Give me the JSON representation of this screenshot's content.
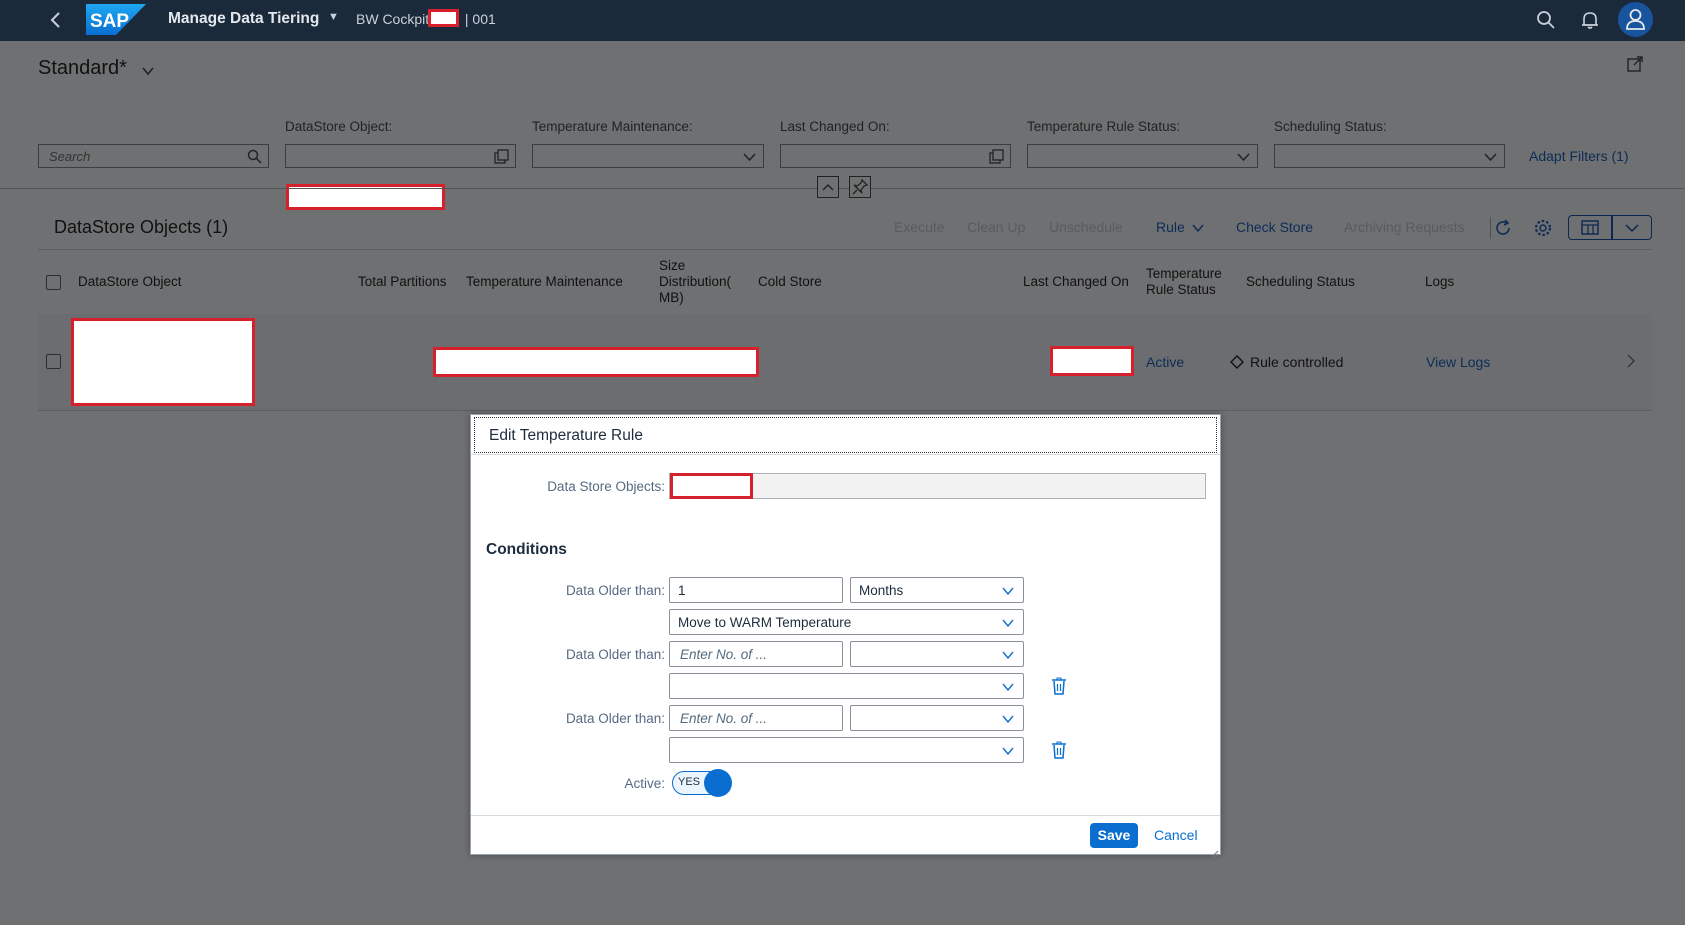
{
  "shell": {
    "logo": "SAP",
    "app_title": "Manage Data Tiering",
    "system_prefix": "BW Cockpit",
    "system_suffix": "| 001"
  },
  "page": {
    "variant": "Standard*",
    "filters": {
      "search_placeholder": "Search",
      "labels": [
        "DataStore Object:",
        "Temperature Maintenance:",
        "Last Changed On:",
        "Temperature Rule Status:",
        "Scheduling Status:"
      ],
      "adapt_filters": "Adapt Filters (1)"
    }
  },
  "table": {
    "title": "DataStore Objects (1)",
    "toolbar": {
      "execute": "Execute",
      "clean_up": "Clean Up",
      "unschedule": "Unschedule",
      "rule": "Rule",
      "check_store": "Check Store",
      "archiving_requests": "Archiving Requests"
    },
    "columns": {
      "dso": "DataStore Object",
      "total_partitions": "Total Partitions",
      "temp_maintenance": "Temperature Maintenance",
      "size_1": "Size",
      "size_2": "Distribution(",
      "size_3": "MB)",
      "cold_store": "Cold Store",
      "last_changed": "Last Changed On",
      "rule_status_1": "Temperature",
      "rule_status_2": "Rule Status",
      "scheduling": "Scheduling Status",
      "logs": "Logs"
    },
    "row": {
      "rule_status": "Active",
      "scheduling_status": "Rule controlled",
      "logs_link": "View Logs"
    }
  },
  "dialog": {
    "title": "Edit Temperature Rule",
    "dso_label": "Data Store Objects:",
    "conditions_heading": "Conditions",
    "conditions": [
      {
        "label": "Data Older than:",
        "amount": "1",
        "unit": "Months",
        "action": "Move to WARM Temperature"
      },
      {
        "label": "Data Older than:",
        "amount_placeholder": "Enter No. of ...",
        "unit": "",
        "action": ""
      },
      {
        "label": "Data Older than:",
        "amount_placeholder": "Enter No. of ...",
        "unit": "",
        "action": ""
      }
    ],
    "active_label": "Active:",
    "active_switch": "YES",
    "save": "Save",
    "cancel": "Cancel"
  },
  "colors": {
    "shell_bg": "#1b2a3b",
    "overlay_bg": "#6e7072",
    "brand_blue": "#0a6ed1",
    "redaction_border": "#d6202b"
  }
}
